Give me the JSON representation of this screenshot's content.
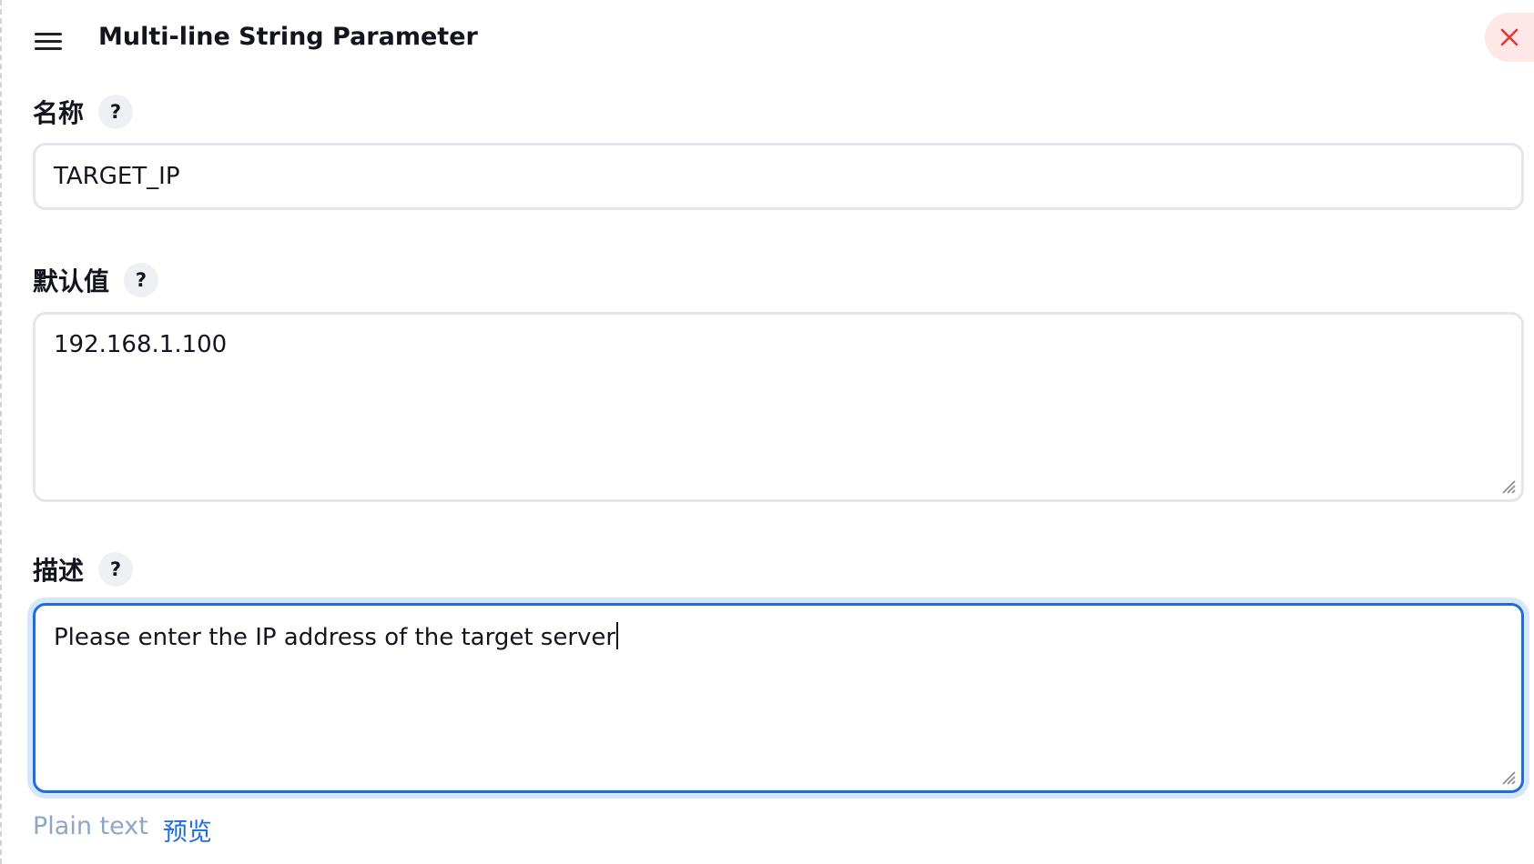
{
  "header": {
    "title": "Multi-line String Parameter",
    "drag_icon": "hamburger-icon",
    "close_icon": "close-icon",
    "close_color": "#e53935"
  },
  "fields": {
    "name": {
      "label": "名称",
      "help": "?",
      "value": "TARGET_IP"
    },
    "default_value": {
      "label": "默认值",
      "help": "?",
      "value": "192.168.1.100"
    },
    "description": {
      "label": "描述",
      "help": "?",
      "value": "Please enter the IP address of the target server",
      "focused": true
    }
  },
  "preview": {
    "plain_text": "Plain text",
    "preview_label": "预览"
  },
  "colors": {
    "accent": "#1b6ee0",
    "focus_ring": "#d6e6fb",
    "border": "#e3e6ea",
    "close_bg": "#fde7e7",
    "muted_link": "#8fa6c4"
  }
}
